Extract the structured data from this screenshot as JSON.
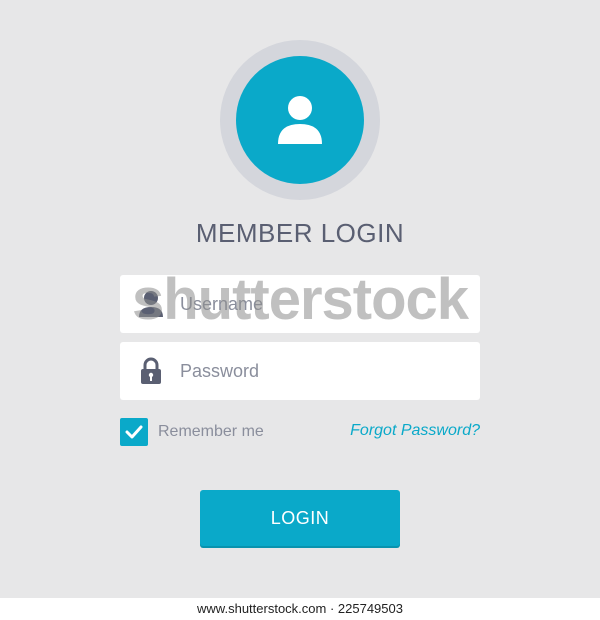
{
  "title": "MEMBER LOGIN",
  "username": {
    "placeholder": "Username",
    "icon": "user-icon"
  },
  "password": {
    "placeholder": "Password",
    "icon": "lock-icon"
  },
  "remember": {
    "label": "Remember me",
    "checked": true
  },
  "forgot_link": "Forgot Password?",
  "login_button": "LOGIN",
  "watermark": "shutterstock",
  "footer": "www.shutterstock.com · 225749503",
  "colors": {
    "accent": "#0aa9c9",
    "background": "#e7e7e8",
    "ring": "#d4d6dc",
    "text": "#5a5f72",
    "muted": "#8a8e9c"
  }
}
